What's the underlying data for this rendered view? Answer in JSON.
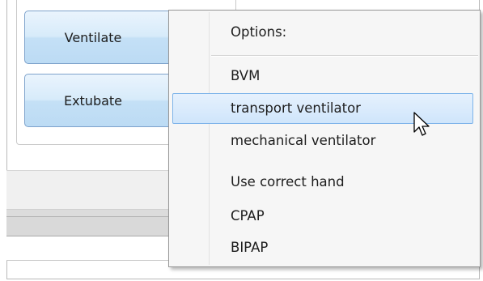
{
  "buttons": [
    {
      "label": "Ventilate"
    },
    {
      "label": "Extubate"
    }
  ],
  "menu": {
    "header": "Options:",
    "items": [
      {
        "label": "BVM",
        "highlighted": false
      },
      {
        "label": "transport ventilator",
        "highlighted": true
      },
      {
        "label": "mechanical ventilator",
        "highlighted": false
      },
      {
        "label": "Use correct hand",
        "highlighted": false
      },
      {
        "label": "CPAP",
        "highlighted": false
      },
      {
        "label": "BIPAP",
        "highlighted": false
      }
    ]
  },
  "cursor": {
    "icon": "mouse-pointer-icon"
  }
}
